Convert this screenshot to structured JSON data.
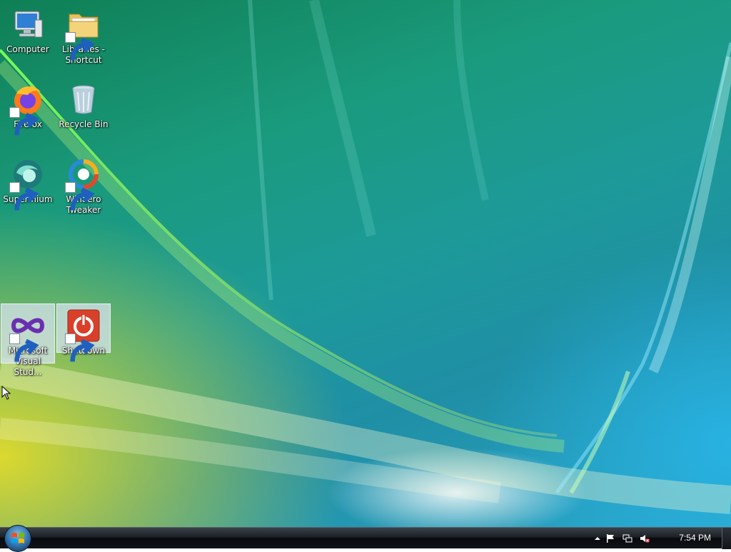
{
  "desktop": {
    "icons": [
      {
        "label": "Computer",
        "shortcut": false,
        "icon": "computer-icon"
      },
      {
        "label": "Libraries -\nShortcut",
        "shortcut": true,
        "icon": "folder-icon"
      },
      {
        "label": "Firefox",
        "shortcut": true,
        "icon": "firefox-icon"
      },
      {
        "label": "Recycle Bin",
        "shortcut": false,
        "icon": "recycle-bin-icon"
      },
      {
        "label": "Supermium",
        "shortcut": true,
        "icon": "supermium-icon"
      },
      {
        "label": "Winaero\nTweaker",
        "shortcut": true,
        "icon": "winaero-tweaker-icon"
      },
      {
        "label": "Microsoft\nVisual Stud...",
        "shortcut": true,
        "icon": "visual-studio-icon",
        "selected": true
      },
      {
        "label": "Shutdown",
        "shortcut": true,
        "icon": "power-icon",
        "selected": true
      }
    ]
  },
  "taskbar": {
    "start_icon": "windows-start-orb-icon",
    "tray_icons": [
      "show-hidden-icons-arrow",
      "action-center-flag-icon",
      "network-icon",
      "volume-muted-icon"
    ],
    "clock": "7:54 PM"
  },
  "colors": {
    "taskbar": "#111418",
    "selection": "#d2e1eb"
  }
}
